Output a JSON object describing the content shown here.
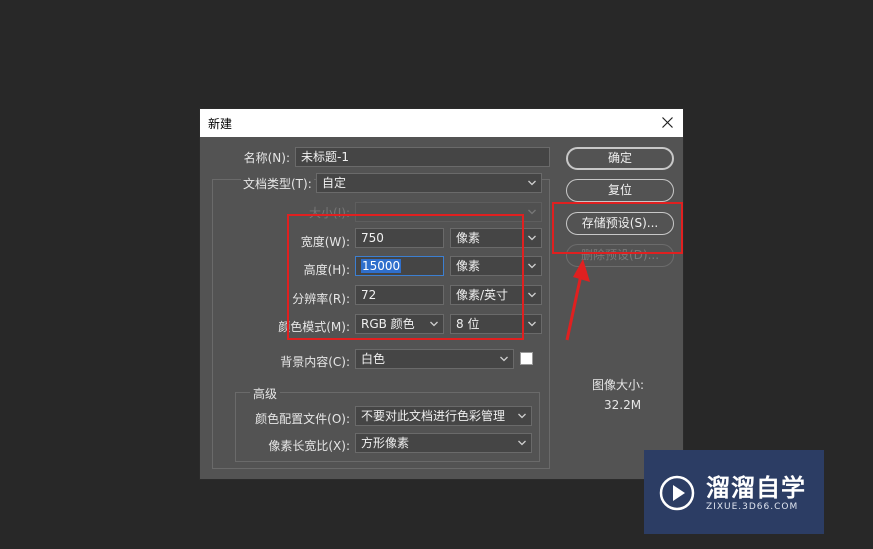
{
  "dialog": {
    "title": "新建",
    "name_label": "名称(N):",
    "name_value": "未标题-1",
    "doc_type_label": "文档类型(T):",
    "doc_type_value": "自定",
    "size_label": "大小(I):",
    "width_label": "宽度(W):",
    "width_value": "750",
    "width_unit": "像素",
    "height_label": "高度(H):",
    "height_value": "15000",
    "height_unit": "像素",
    "resolution_label": "分辨率(R):",
    "resolution_value": "72",
    "resolution_unit": "像素/英寸",
    "color_mode_label": "颜色模式(M):",
    "color_mode_value": "RGB 颜色",
    "bit_depth_value": "8 位",
    "background_label": "背景内容(C):",
    "background_value": "白色",
    "advanced_label": "高级",
    "color_profile_label": "颜色配置文件(O):",
    "color_profile_value": "不要对此文档进行色彩管理",
    "pixel_aspect_label": "像素长宽比(X):",
    "pixel_aspect_value": "方形像素",
    "image_size_label": "图像大小:",
    "image_size_value": "32.2M"
  },
  "buttons": {
    "ok": "确定",
    "reset": "复位",
    "save_preset": "存储预设(S)...",
    "delete_preset": "删除预设(D)..."
  },
  "watermark": {
    "name": "溜溜自学",
    "url": "ZIXUE.3D66.COM"
  },
  "colors": {
    "annotation": "#e02020",
    "dialog_bg": "#535353",
    "watermark_bg": "#2c3d64"
  }
}
